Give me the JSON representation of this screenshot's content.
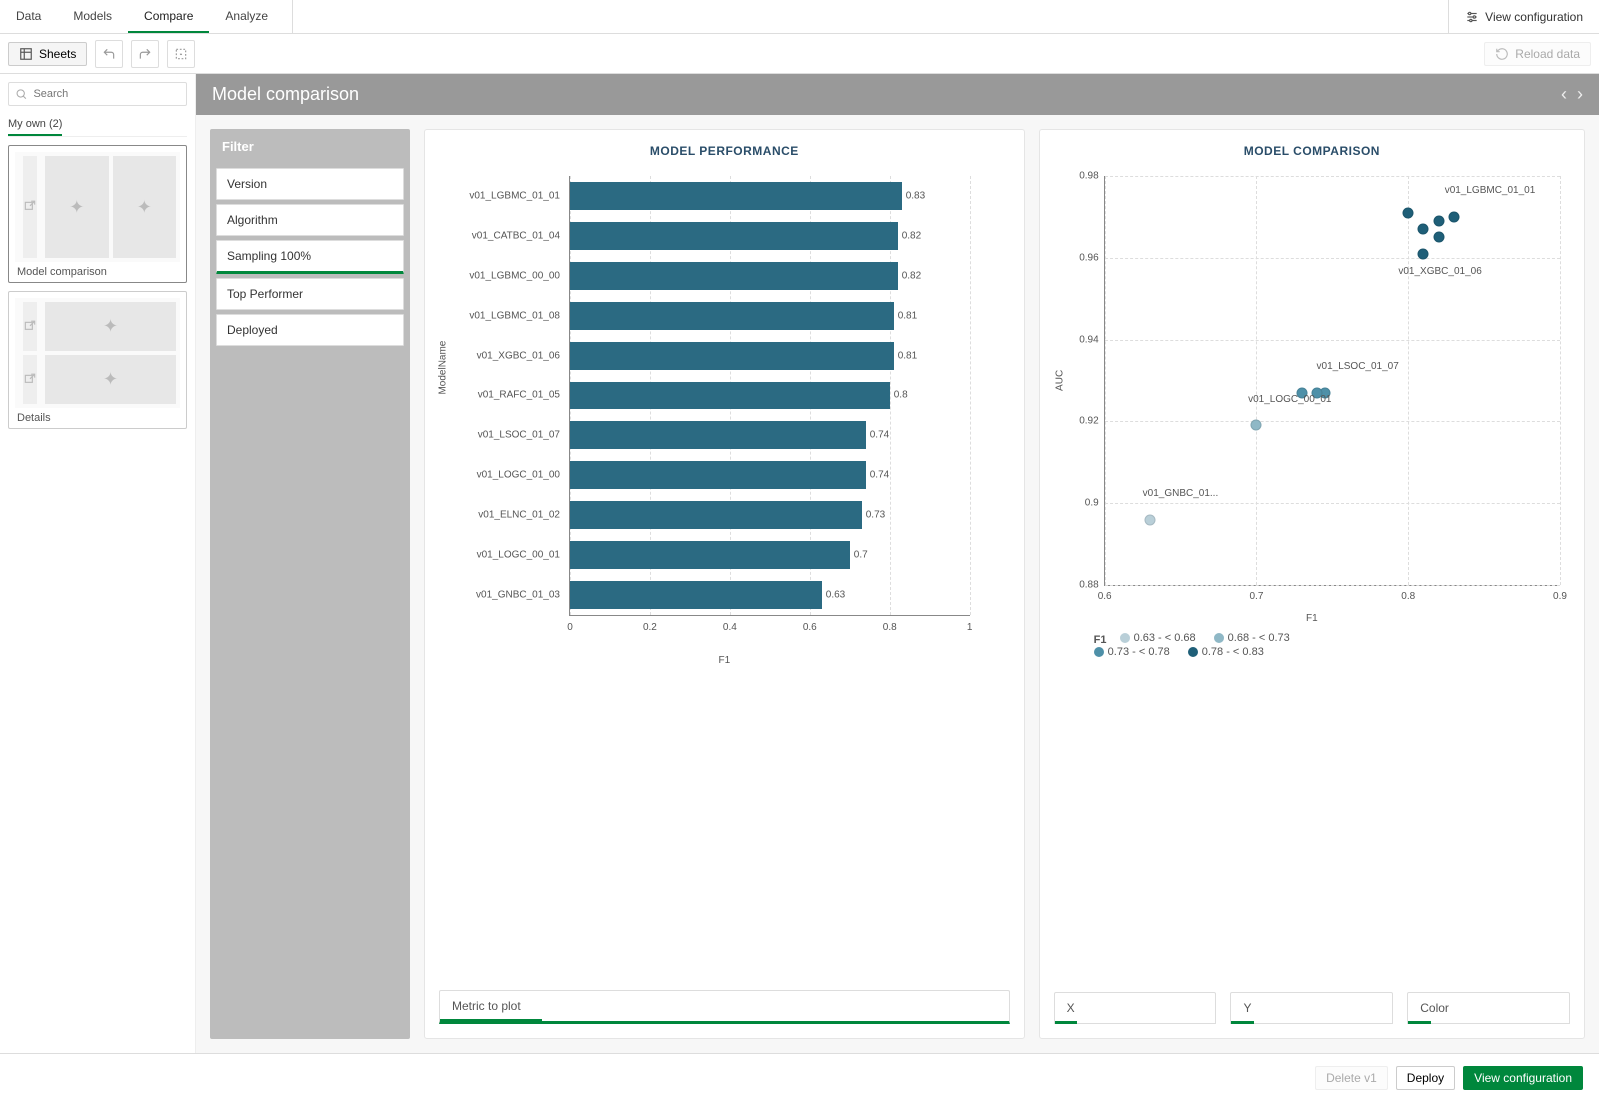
{
  "topnav": {
    "tabs": [
      "Data",
      "Models",
      "Compare",
      "Analyze"
    ],
    "active": 2,
    "viewConfig": "View configuration"
  },
  "toolbar": {
    "sheets": "Sheets",
    "reload": "Reload data"
  },
  "sidebar": {
    "searchPlaceholder": "Search",
    "tab": "My own (2)",
    "sheets": [
      {
        "name": "Model comparison"
      },
      {
        "name": "Details"
      }
    ]
  },
  "page": {
    "title": "Model comparison"
  },
  "filter": {
    "title": "Filter",
    "items": [
      "Version",
      "Algorithm",
      "Sampling 100%",
      "Top Performer",
      "Deployed"
    ],
    "activeIndex": 2
  },
  "barCard": {
    "title": "MODEL PERFORMANCE",
    "metricLabel": "Metric to plot"
  },
  "scatterCard": {
    "title": "MODEL COMPARISON",
    "controls": {
      "x": "X",
      "y": "Y",
      "color": "Color"
    }
  },
  "footer": {
    "delete": "Delete v1",
    "deploy": "Deploy",
    "viewConfig": "View configuration"
  },
  "chart_data": [
    {
      "type": "bar",
      "title": "MODEL PERFORMANCE",
      "orientation": "horizontal",
      "xlabel": "F1",
      "ylabel": "ModelName",
      "xlim": [
        0,
        1
      ],
      "xticks": [
        0,
        0.2,
        0.4,
        0.6,
        0.8,
        1
      ],
      "categories": [
        "v01_LGBMC_01_01",
        "v01_CATBC_01_04",
        "v01_LGBMC_00_00",
        "v01_LGBMC_01_08",
        "v01_XGBC_01_06",
        "v01_RAFC_01_05",
        "v01_LSOC_01_07",
        "v01_LOGC_01_00",
        "v01_ELNC_01_02",
        "v01_LOGC_00_01",
        "v01_GNBC_01_03"
      ],
      "values": [
        0.83,
        0.82,
        0.82,
        0.81,
        0.81,
        0.8,
        0.74,
        0.74,
        0.73,
        0.7,
        0.63
      ]
    },
    {
      "type": "scatter",
      "title": "MODEL COMPARISON",
      "xlabel": "F1",
      "ylabel": "AUC",
      "xlim": [
        0.6,
        0.9
      ],
      "ylim": [
        0.88,
        0.98
      ],
      "xticks": [
        0.6,
        0.7,
        0.8,
        0.9
      ],
      "yticks": [
        0.88,
        0.9,
        0.92,
        0.94,
        0.96,
        0.98
      ],
      "color_label": "F1",
      "legend": [
        {
          "label": "0.63 - < 0.68",
          "color": "#b9cfd8"
        },
        {
          "label": "0.68 - < 0.73",
          "color": "#8fb8c6"
        },
        {
          "label": "0.73 - < 0.78",
          "color": "#4e90a8"
        },
        {
          "label": "0.78 - < 0.83",
          "color": "#1f5f78"
        }
      ],
      "points": [
        {
          "name": "v01_LGBMC_01_01",
          "f1": 0.83,
          "auc": 0.97,
          "color": "#1f5f78",
          "label": "v01_LGBMC_01_01",
          "labelPos": "top"
        },
        {
          "name": "v01_CATBC_01_04",
          "f1": 0.82,
          "auc": 0.969,
          "color": "#1f5f78"
        },
        {
          "name": "v01_LGBMC_00_00",
          "f1": 0.82,
          "auc": 0.965,
          "color": "#1f5f78"
        },
        {
          "name": "v01_LGBMC_01_08",
          "f1": 0.81,
          "auc": 0.967,
          "color": "#1f5f78"
        },
        {
          "name": "v01_RAFC_01_05",
          "f1": 0.8,
          "auc": 0.971,
          "color": "#1f5f78"
        },
        {
          "name": "v01_XGBC_01_06",
          "f1": 0.81,
          "auc": 0.961,
          "color": "#1f5f78",
          "label": "v01_XGBC_01_06",
          "labelPos": "bottom"
        },
        {
          "name": "v01_LSOC_01_07",
          "f1": 0.745,
          "auc": 0.927,
          "color": "#4e90a8",
          "label": "v01_LSOC_01_07",
          "labelPos": "top"
        },
        {
          "name": "v01_LOGC_01_00",
          "f1": 0.74,
          "auc": 0.927,
          "color": "#4e90a8"
        },
        {
          "name": "v01_ELNC_01_02",
          "f1": 0.73,
          "auc": 0.927,
          "color": "#4e90a8"
        },
        {
          "name": "v01_LOGC_00_01",
          "f1": 0.7,
          "auc": 0.919,
          "color": "#8fb8c6",
          "label": "v01_LOGC_00_01",
          "labelPos": "top"
        },
        {
          "name": "v01_GNBC_01_03",
          "f1": 0.63,
          "auc": 0.896,
          "color": "#b9cfd8",
          "label": "v01_GNBC_01...",
          "labelPos": "top"
        }
      ]
    }
  ]
}
